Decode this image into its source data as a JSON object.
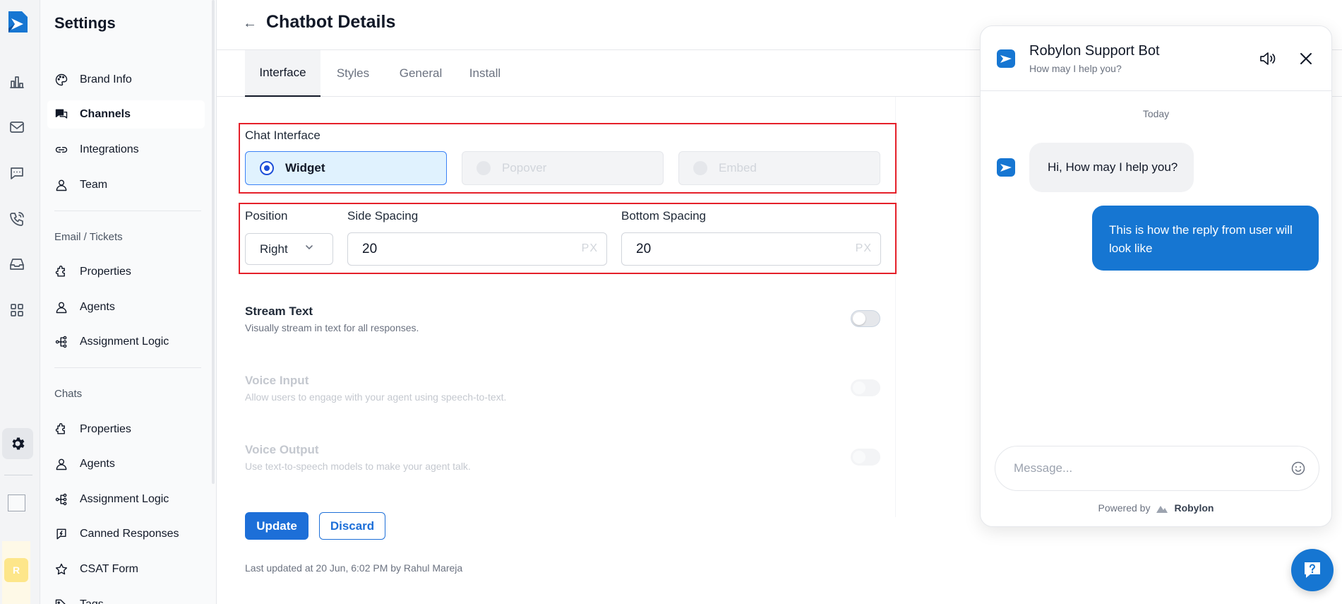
{
  "sidebar": {
    "title": "Settings",
    "items_top": [
      {
        "label": "Brand Info",
        "icon": "palette-icon",
        "active": false
      },
      {
        "label": "Channels",
        "icon": "chat-bubbles-icon",
        "active": true
      },
      {
        "label": "Integrations",
        "icon": "link-icon",
        "active": false
      },
      {
        "label": "Team",
        "icon": "user-icon",
        "active": false
      }
    ],
    "section_email": "Email / Tickets",
    "items_email": [
      {
        "label": "Properties",
        "icon": "puzzle-icon"
      },
      {
        "label": "Agents",
        "icon": "user-icon"
      },
      {
        "label": "Assignment Logic",
        "icon": "tree-icon"
      }
    ],
    "section_chats": "Chats",
    "items_chats": [
      {
        "label": "Properties",
        "icon": "puzzle-icon"
      },
      {
        "label": "Agents",
        "icon": "user-icon"
      },
      {
        "label": "Assignment Logic",
        "icon": "tree-icon"
      },
      {
        "label": "Canned Responses",
        "icon": "quick-reply-icon"
      },
      {
        "label": "CSAT Form",
        "icon": "star-icon"
      },
      {
        "label": "Tags",
        "icon": "tag-icon"
      }
    ]
  },
  "rail": {
    "avatar_initial": "R"
  },
  "header": {
    "back_glyph": "←",
    "title": "Chatbot Details"
  },
  "tabs": [
    {
      "label": "Interface",
      "active": true
    },
    {
      "label": "Styles",
      "active": false
    },
    {
      "label": "General",
      "active": false
    },
    {
      "label": "Install",
      "active": false
    }
  ],
  "chat_interface": {
    "label": "Chat Interface",
    "options": [
      {
        "label": "Widget",
        "selected": true,
        "disabled": false
      },
      {
        "label": "Popover",
        "selected": false,
        "disabled": true
      },
      {
        "label": "Embed",
        "selected": false,
        "disabled": true
      }
    ]
  },
  "position": {
    "label": "Position",
    "value": "Right",
    "side_spacing_label": "Side Spacing",
    "side_spacing_value": "20",
    "bottom_spacing_label": "Bottom Spacing",
    "bottom_spacing_value": "20",
    "unit": "PX"
  },
  "settings": [
    {
      "title": "Stream Text",
      "desc": "Visually stream in text for all responses.",
      "enabled": true,
      "on": false
    },
    {
      "title": "Voice Input",
      "desc": "Allow users to engage with your agent using speech-to-text.",
      "enabled": false,
      "on": false
    },
    {
      "title": "Voice Output",
      "desc": "Use text-to-speech models to make your agent talk.",
      "enabled": false,
      "on": false
    }
  ],
  "actions": {
    "update": "Update",
    "discard": "Discard"
  },
  "last_updated": "Last updated at 20 Jun, 6:02 PM by Rahul Mareja",
  "chat": {
    "title": "Robylon Support Bot",
    "subtitle": "How may I help you?",
    "date_divider": "Today",
    "bot_message": "Hi, How may I help you?",
    "user_message": "This is how the reply from user will look like",
    "input_placeholder": "Message...",
    "powered_by": "Powered by",
    "brand": "Robylon"
  },
  "colors": {
    "primary": "#1676d2",
    "highlight_frame": "#e5202a",
    "selected_bg": "#e0f2fe"
  }
}
